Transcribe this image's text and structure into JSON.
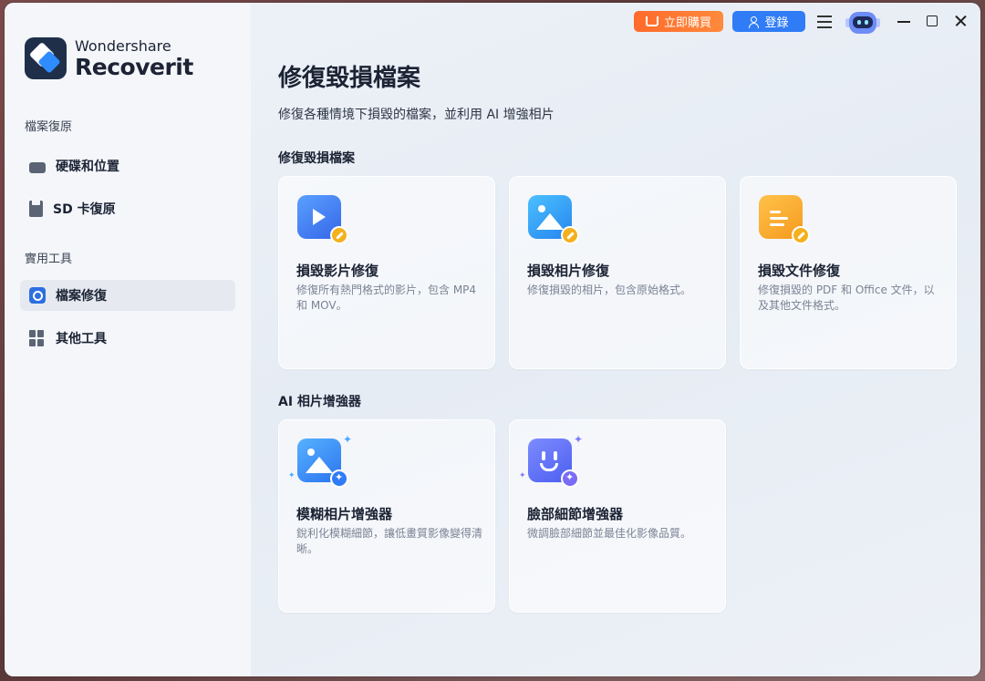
{
  "app": {
    "brand": "Wondershare",
    "product": "Recoverit"
  },
  "topbar": {
    "buy_label": "立即購買",
    "login_label": "登錄"
  },
  "sidebar": {
    "sections": [
      {
        "label": "檔案復原"
      },
      {
        "label": "實用工具"
      }
    ],
    "items": [
      {
        "label": "硬碟和位置",
        "icon": "hard-drive-icon",
        "active": false
      },
      {
        "label": "SD 卡復原",
        "icon": "sd-card-icon",
        "active": false
      },
      {
        "label": "檔案修復",
        "icon": "file-repair-icon",
        "active": true
      },
      {
        "label": "其他工具",
        "icon": "tools-icon",
        "active": false
      }
    ]
  },
  "main": {
    "title": "修復毀損檔案",
    "subtitle": "修復各種情境下損毀的檔案，並利用 AI 增強相片",
    "groups": [
      {
        "title": "修復毀損檔案",
        "cards": [
          {
            "title": "損毀影片修復",
            "desc": "修復所有熱門格式的影片，包含 MP4 和 MOV。",
            "icon": "video-repair-icon",
            "color": "#3f7bf5"
          },
          {
            "title": "損毀相片修復",
            "desc": "修復損毀的相片，包含原始格式。",
            "icon": "photo-repair-icon",
            "color": "#2fa6f7"
          },
          {
            "title": "損毀文件修復",
            "desc": "修復損毀的 PDF 和 Office 文件，以及其他文件格式。",
            "icon": "document-repair-icon",
            "color": "#f5a623"
          }
        ]
      },
      {
        "title": "AI 相片增強器",
        "cards": [
          {
            "title": "模糊相片增強器",
            "desc": "銳利化模糊細節，讓低畫質影像變得清晰。",
            "icon": "photo-enhance-icon",
            "color": "#2f8cf7"
          },
          {
            "title": "臉部細節增強器",
            "desc": "微調臉部細節並最佳化影像品質。",
            "icon": "face-enhance-icon",
            "color": "#5e6ef5"
          }
        ]
      }
    ]
  }
}
